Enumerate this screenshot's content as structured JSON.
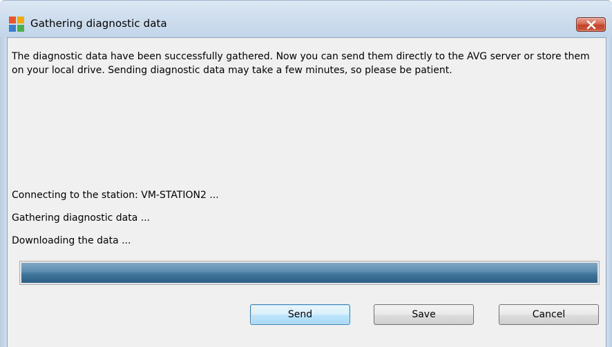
{
  "window": {
    "title": "Gathering diagnostic data",
    "close_icon": "close-x-icon",
    "app_icon": "avg-logo-icon"
  },
  "message": "The diagnostic data have been successfully gathered. Now you can send them directly to the AVG server or store them on your local drive. Sending diagnostic data may take a few minutes, so please be patient.",
  "status": {
    "connecting": "Connecting to the station: VM-STATION2 ...",
    "gathering": "Gathering diagnostic data ...",
    "downloading": "Downloading the data ..."
  },
  "progress": {
    "value": 1.0
  },
  "buttons": {
    "send": "Send",
    "save": "Save",
    "cancel": "Cancel"
  },
  "colors": {
    "progress": "#3f7399",
    "close_button": "#c2432a"
  }
}
